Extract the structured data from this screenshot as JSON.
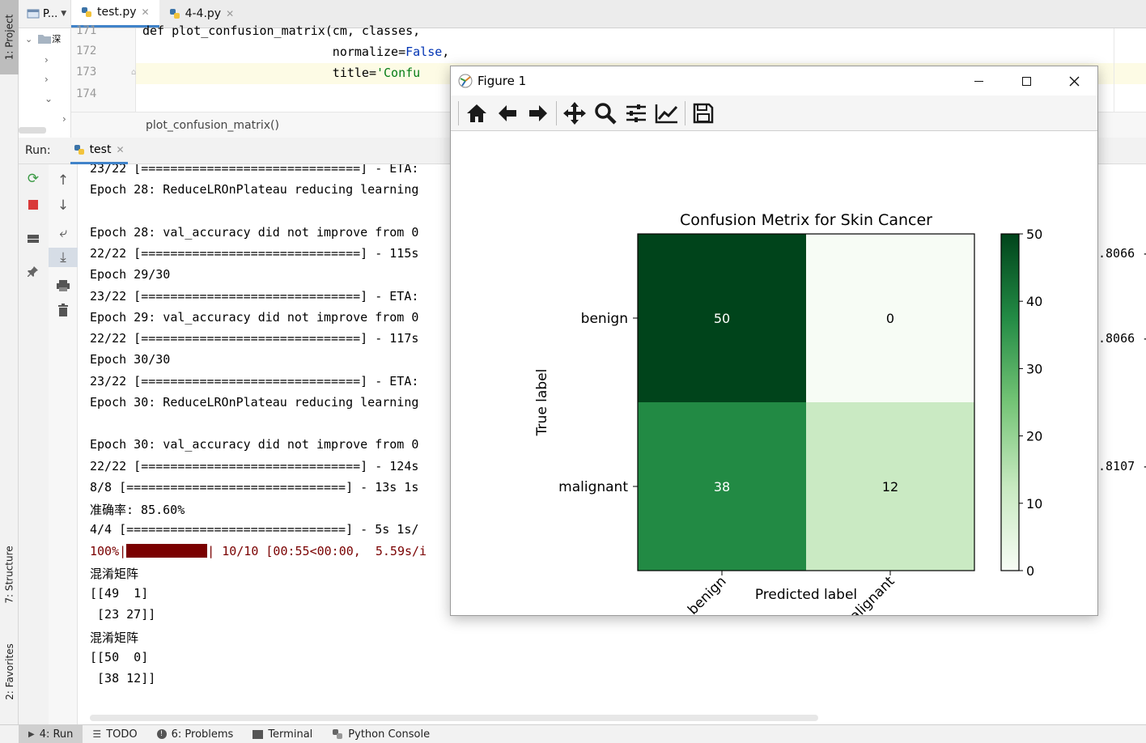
{
  "left_strip": {
    "project_tab": "1: Project",
    "structure_tab": "7: Structure",
    "favorites_tab": "2: Favorites"
  },
  "project_panel": {
    "label": "P...",
    "root_label": "深"
  },
  "editor_tabs": [
    {
      "label": "test.py",
      "active": true
    },
    {
      "label": "4-4.py",
      "active": false
    }
  ],
  "editor": {
    "lines": [
      {
        "number": "171",
        "code": "def plot_confusion_matrix(cm, classes,"
      },
      {
        "number": "172",
        "code_prefix": "                          normalize=",
        "code_keyword": "False",
        "code_suffix": ","
      },
      {
        "number": "173",
        "code_prefix": "                          title=",
        "code_string": "'Confu"
      },
      {
        "number": "174",
        "code": ""
      }
    ],
    "breadcrumb": "plot_confusion_matrix()"
  },
  "run_window": {
    "label": "Run:",
    "tab": "test"
  },
  "console_lines": [
    "23/22 [==============================] - ETA:",
    "Epoch 28: ReduceLROnPlateau reducing learning",
    "",
    "Epoch 28: val_accuracy did not improve from 0",
    "22/22 [==============================] - 115s",
    "Epoch 29/30",
    "23/22 [==============================] - ETA:",
    "Epoch 29: val_accuracy did not improve from 0",
    "22/22 [==============================] - 117s",
    "Epoch 30/30",
    "23/22 [==============================] - ETA:",
    "Epoch 30: ReduceLROnPlateau reducing learning",
    "",
    "Epoch 30: val_accuracy did not improve from 0",
    "22/22 [==============================] - 124s",
    "8/8 [==============================] - 13s 1s",
    "准确率: 85.60%",
    "4/4 [==============================] - 5s 1s/",
    "",
    "混淆矩阵",
    "[[49  1]",
    " [23 27]]",
    "混淆矩阵",
    "[[50  0]",
    " [38 12]]"
  ],
  "progress_line": {
    "prefix": "100%|",
    "suffix": "| 10/10 [00:55<00:00,  5.59s/i"
  },
  "right_values": [
    ".8066 -",
    ".8066 -",
    ".8107 -"
  ],
  "status_bar": [
    {
      "label": "4: Run",
      "active": true,
      "icon": "play-icon"
    },
    {
      "label": "TODO",
      "active": false,
      "icon": "list-icon"
    },
    {
      "label": "6: Problems",
      "active": false,
      "icon": "problems-icon"
    },
    {
      "label": "Terminal",
      "active": false,
      "icon": "terminal-icon"
    },
    {
      "label": "Python Console",
      "active": false,
      "icon": "python-icon"
    }
  ],
  "figure_window": {
    "title": "Figure 1",
    "toolbar_icons": [
      "home-icon",
      "back-arrow-icon",
      "forward-arrow-icon",
      "pan-icon",
      "zoom-icon",
      "configure-subplots-icon",
      "edit-axes-icon",
      "save-icon"
    ]
  },
  "chart_data": {
    "type": "heatmap",
    "title": "Confusion Metrix for Skin Cancer",
    "xlabel": "Predicted label",
    "ylabel": "True label",
    "x_categories": [
      "benign",
      "malignant"
    ],
    "y_categories": [
      "benign",
      "malignant"
    ],
    "values": [
      [
        50,
        0
      ],
      [
        38,
        12
      ]
    ],
    "colormap": "Greens",
    "colorbar": {
      "min": 0,
      "max": 50,
      "ticks": [
        0,
        10,
        20,
        30,
        40,
        50
      ]
    },
    "cell_colors": [
      [
        "#00441b",
        "#f7fcf5"
      ],
      [
        "#228a44",
        "#caeac3"
      ]
    ],
    "text_colors": [
      [
        "#ffffff",
        "#000000"
      ],
      [
        "#ffffff",
        "#000000"
      ]
    ]
  }
}
